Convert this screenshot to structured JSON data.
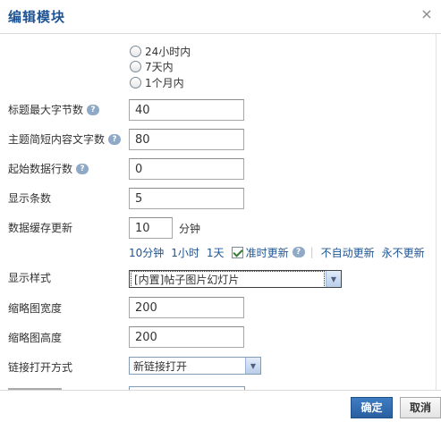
{
  "dialog": {
    "title": "编辑模块",
    "close_glyph": "×"
  },
  "radios": [
    {
      "label": "24小时内"
    },
    {
      "label": "7天内"
    },
    {
      "label": "1个月内"
    }
  ],
  "fields": {
    "title_max_bytes": {
      "label": "标题最大字节数",
      "value": "40"
    },
    "summary_chars": {
      "label": "主题简短内容文字数",
      "value": "80"
    },
    "start_row": {
      "label": "起始数据行数",
      "value": "0"
    },
    "display_count": {
      "label": "显示条数",
      "value": "5"
    },
    "cache_update": {
      "label": "数据缓存更新",
      "value": "10",
      "unit": "分钟"
    },
    "thumb_width": {
      "label": "缩略图宽度",
      "value": "200"
    },
    "thumb_height": {
      "label": "缩略图高度",
      "value": "200"
    }
  },
  "cache_links": {
    "ten_min": "10分钟",
    "one_hour": "1小时",
    "one_day": "1天",
    "on_time_label": "准时更新",
    "on_time_checked": true,
    "no_auto": "不自动更新",
    "never": "永不更新"
  },
  "selects": {
    "display_style": {
      "label": "显示样式",
      "value": "[内置]帖子图片幻灯片"
    },
    "link_open": {
      "label": "链接打开方式",
      "value": "新链接打开"
    }
  },
  "footer": {
    "ok_label": "确定",
    "cancel_label": "取消"
  },
  "icons": {
    "help": "help-icon",
    "dropdown": "chevron-down-icon",
    "close": "close-icon"
  }
}
